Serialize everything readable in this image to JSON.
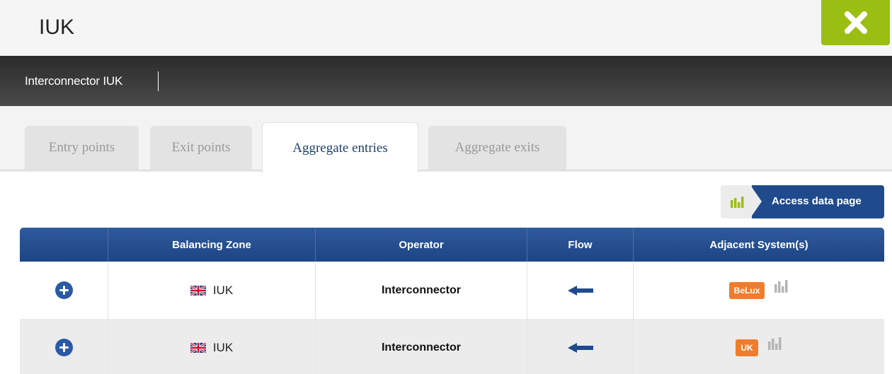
{
  "header": {
    "title": "IUK",
    "close_icon": "close-x-icon"
  },
  "nav": {
    "label": "Interconnector IUK"
  },
  "tabs": [
    {
      "label": "Entry points",
      "active": false
    },
    {
      "label": "Exit points",
      "active": false
    },
    {
      "label": "Aggregate entries",
      "active": true
    },
    {
      "label": "Aggregate exits",
      "active": false
    }
  ],
  "access": {
    "label": "Access data page",
    "icon": "bar-chart-icon"
  },
  "table": {
    "columns": [
      "",
      "Balancing Zone",
      "Operator",
      "Flow",
      "Adjacent System(s)"
    ],
    "rows": [
      {
        "zone": "IUK",
        "operator": "Interconnector",
        "flow": "arrow-left",
        "adjacent": "BeLux"
      },
      {
        "zone": "IUK",
        "operator": "Interconnector",
        "flow": "arrow-left",
        "adjacent": "UK"
      }
    ]
  },
  "colors": {
    "accent_green": "#9bbe12",
    "brand_blue": "#1f4b8c",
    "badge_orange": "#f07c2c"
  }
}
